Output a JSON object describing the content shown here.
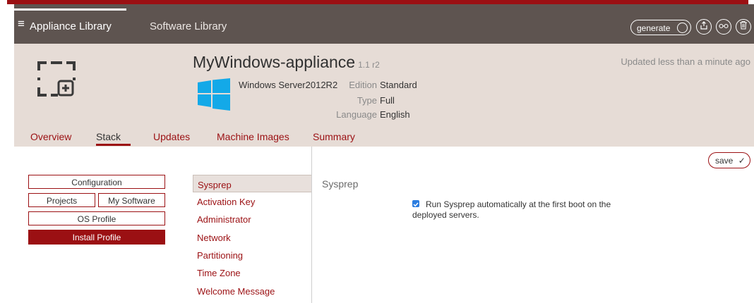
{
  "nav": {
    "menu_icon": "hamburger-icon",
    "primary_link": "Appliance Library",
    "secondary_link": "Software Library",
    "generate_label": "generate",
    "icons": [
      "refresh-icon",
      "export-icon",
      "link-icon",
      "trash-icon"
    ]
  },
  "appliance": {
    "name": "MyWindows-appliance",
    "version": "1.1 r2",
    "updated": "Updated less than a minute ago",
    "os_name": "Windows Server2012R2",
    "logo_icon": "windows-logo-icon",
    "placeholder_icon": "appliance-placeholder-icon",
    "details": [
      {
        "key": "Edition",
        "value": "Standard"
      },
      {
        "key": "Type",
        "value": "Full"
      },
      {
        "key": "Language",
        "value": "English"
      }
    ]
  },
  "tabs": [
    {
      "label": "Overview"
    },
    {
      "label": "Stack"
    },
    {
      "label": "Updates"
    },
    {
      "label": "Machine Images"
    },
    {
      "label": "Summary"
    }
  ],
  "active_tab": "Stack",
  "stack_buttons": {
    "configuration": "Configuration",
    "projects": "Projects",
    "my_software": "My Software",
    "os_profile": "OS Profile",
    "install_profile": "Install Profile"
  },
  "submenu": [
    {
      "label": "Sysprep"
    },
    {
      "label": "Activation Key"
    },
    {
      "label": "Administrator"
    },
    {
      "label": "Network"
    },
    {
      "label": "Partitioning"
    },
    {
      "label": "Time Zone"
    },
    {
      "label": "Welcome Message"
    }
  ],
  "content": {
    "section_title": "Sysprep",
    "save_label": "save",
    "checkbox_checked": true,
    "checkbox_label": "Run Sysprep automatically at the first boot on the deployed servers."
  },
  "colors": {
    "accent": "#9b1013",
    "navbar": "#5e5450",
    "header_bg": "#e6dcd6",
    "checkbox": "#2b7de0"
  }
}
